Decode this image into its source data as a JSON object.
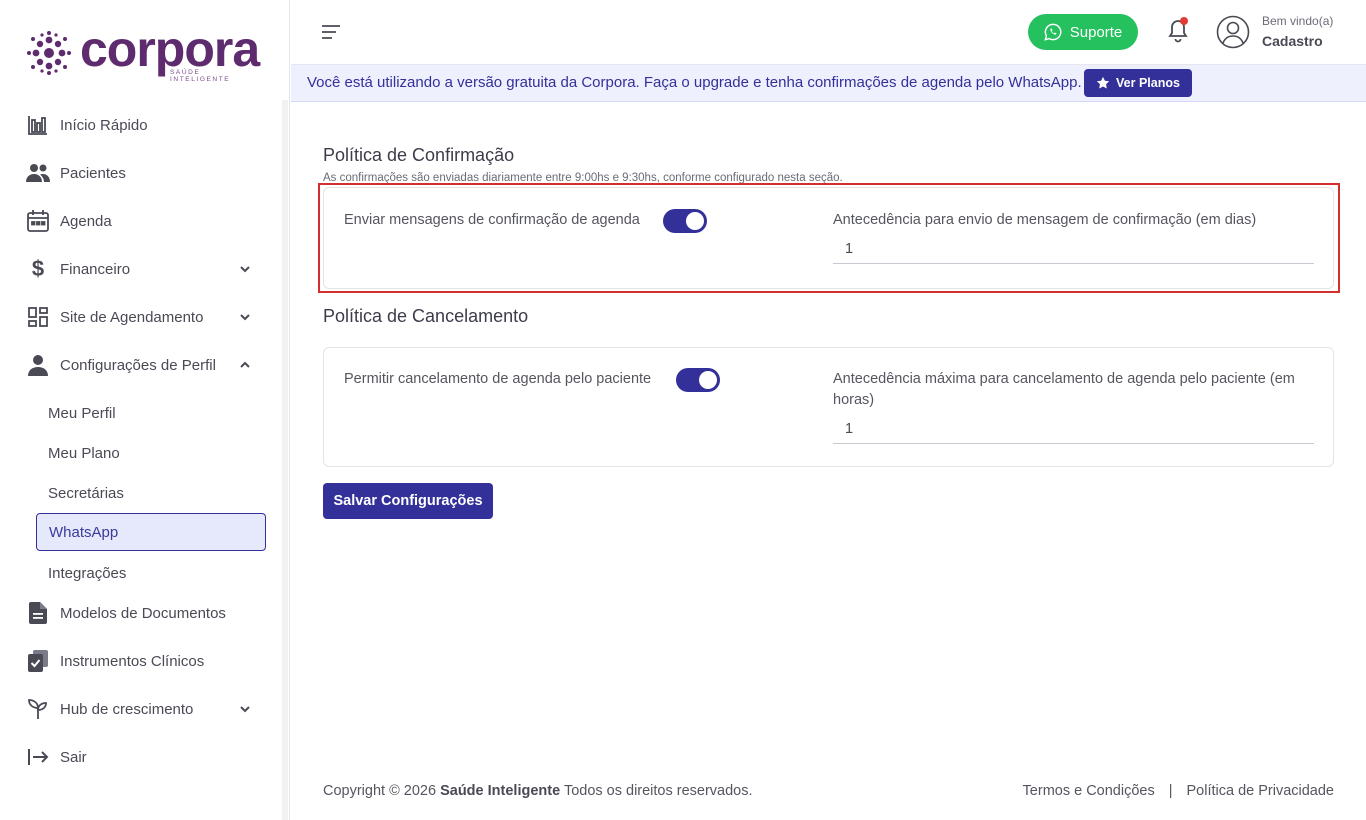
{
  "brand": {
    "name": "corpora",
    "tagline": "SAÚDE INTELIGENTE"
  },
  "colors": {
    "primary": "#34309a",
    "brand": "#5e2b6e",
    "support": "#25c15e",
    "alert": "#e53935"
  },
  "sidebar": {
    "items": [
      {
        "label": "Início Rápido",
        "icon": "chart-bars-icon"
      },
      {
        "label": "Pacientes",
        "icon": "users-icon"
      },
      {
        "label": "Agenda",
        "icon": "calendar-icon"
      },
      {
        "label": "Financeiro",
        "icon": "dollar-icon",
        "expandable": true
      },
      {
        "label": "Site de Agendamento",
        "icon": "dashboard-grid-icon",
        "expandable": true
      },
      {
        "label": "Configurações de Perfil",
        "icon": "person-icon",
        "expandable": true,
        "expanded": true
      },
      {
        "label": "Modelos de Documentos",
        "icon": "document-icon"
      },
      {
        "label": "Instrumentos Clínicos",
        "icon": "clipboard-check-icon"
      },
      {
        "label": "Hub de crescimento",
        "icon": "sprout-icon",
        "expandable": true
      },
      {
        "label": "Sair",
        "icon": "logout-icon"
      }
    ],
    "subitems": [
      {
        "label": "Meu Perfil"
      },
      {
        "label": "Meu Plano"
      },
      {
        "label": "Secretárias"
      },
      {
        "label": "WhatsApp",
        "active": true
      },
      {
        "label": "Integrações"
      }
    ]
  },
  "header": {
    "support_label": "Suporte",
    "welcome": "Bem vindo(a)",
    "user": "Cadastro"
  },
  "banner": {
    "text": "Você está utilizando a versão gratuita da Corpora. Faça o upgrade e tenha confirmações de agenda pelo WhatsApp.",
    "button": "Ver Planos"
  },
  "confirmation": {
    "title": "Política de Confirmação",
    "subtitle": "As confirmações são enviadas diariamente entre 9:00hs e 9:30hs, conforme configurado nesta seção.",
    "toggle_label": "Enviar mensagens de confirmação de agenda",
    "toggle_on": true,
    "field_label": "Antecedência para envio de mensagem de confirmação (em dias)",
    "field_value": "1"
  },
  "cancellation": {
    "title": "Política de Cancelamento",
    "toggle_label": "Permitir cancelamento de agenda pelo paciente",
    "toggle_on": true,
    "field_label": "Antecedência máxima para cancelamento de agenda pelo paciente (em horas)",
    "field_value": "1"
  },
  "save_label": "Salvar Configurações",
  "footer": {
    "copyright": "Copyright © 2026",
    "company": "Saúde Inteligente",
    "rights": "Todos os direitos reservados.",
    "terms": "Termos e Condições",
    "privacy": "Política de Privacidade"
  }
}
